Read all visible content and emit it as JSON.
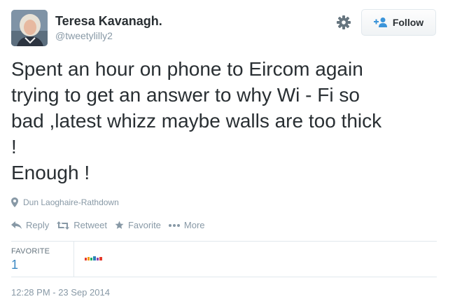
{
  "user": {
    "display_name": "Teresa Kavanagh.",
    "handle": "@tweetylilly2",
    "avatar_icon": "user-photo"
  },
  "header": {
    "settings_icon": "gear-icon",
    "follow_label": "Follow",
    "follow_icon": "add-person-icon"
  },
  "tweet": {
    "text": "Spent an hour on phone to Eircom again\ntrying to get an answer to why Wi - Fi so\nbad ,latest whizz  maybe walls are too thick\n!\nEnough !"
  },
  "location": {
    "icon": "map-pin-icon",
    "name": "Dun Laoghaire-Rathdown"
  },
  "actions": [
    {
      "icon": "reply-icon",
      "label": "Reply"
    },
    {
      "icon": "retweet-icon",
      "label": "Retweet"
    },
    {
      "icon": "star-icon",
      "label": "Favorite"
    },
    {
      "icon": "more-icon",
      "label": "More"
    }
  ],
  "stats": {
    "favorite_label": "FAVORITE",
    "favorite_count": "1",
    "favoriter_avatar": "toysrus-logo"
  },
  "timestamp": "12:28 PM - 23 Sep 2014",
  "colors": {
    "text": "#292f33",
    "muted": "#8899a6",
    "link": "#3b88c3",
    "border": "#e1e8ed"
  }
}
